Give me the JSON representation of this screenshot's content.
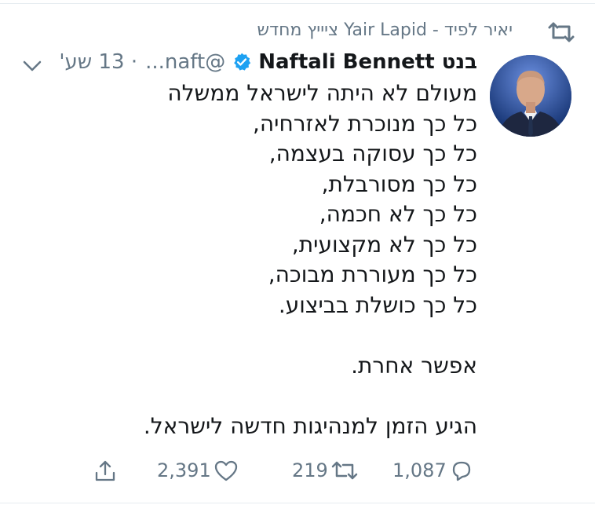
{
  "retweet": {
    "text": "יאיר לפיד - Yair Lapid ציייץ מחדש",
    "icon": "retweet-icon"
  },
  "author": {
    "name": "בנט Naftali Bennett",
    "handle": "@naft...",
    "time": "· 13 שע'",
    "verified_icon": "verified-badge-icon",
    "avatar": "avatar"
  },
  "tweet": {
    "lines": [
      "מעולם לא היתה לישראל ממשלה",
      "כל כך מנוכרת לאזרחיה,",
      "כל כך עסוקה בעצמה,",
      "כל כך מסורבלת,",
      "כל כך לא חכמה,",
      "כל כך לא מקצועית,",
      "כל כך מעוררת מבוכה,",
      "כל כך כושלת בביצוע.",
      "",
      "אפשר אחרת.",
      "",
      "הגיע הזמן למנהיגות חדשה לישראל."
    ]
  },
  "actions": {
    "replies": "1,087",
    "retweets": "219",
    "likes": "2,391"
  },
  "colors": {
    "secondary_text": "#657786",
    "verified_blue": "#1da1f2",
    "text": "#14171a"
  }
}
